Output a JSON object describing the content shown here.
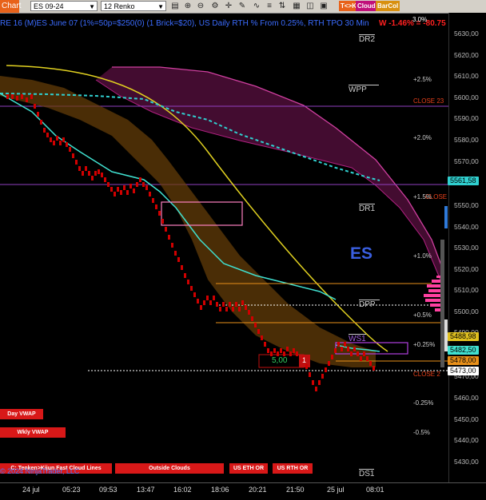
{
  "toolbar": {
    "chart_tab": "Chart",
    "instrument": "ES 09-24",
    "bar_type": "12 Renko",
    "btn_tok": "T<>K",
    "btn_cloud": "Cloud",
    "btn_barcol": "BarCol"
  },
  "header": {
    "title": "RE 16 (M)ES June 07 (1%=50p=$250(0) (1 Brick=$20), US Daily RTH % From 0.25%, RTH TPO 30 Min",
    "performance": "W -1.46% = -80.75",
    "top_pct": "3.0%"
  },
  "price_axis": [
    "5630,00",
    "5620,00",
    "5610,00",
    "5600,00",
    "5590,00",
    "5580,00",
    "5570,00",
    "5550,00",
    "5540,00",
    "5530,00",
    "5520,00",
    "5510,00",
    "5500,00",
    "5490,00",
    "5470,00",
    "5460,00",
    "5450,00",
    "5440,00",
    "5430,00"
  ],
  "price_tags": {
    "tag1": "5561,58",
    "tag2": "5488,98",
    "tag3": "5482,50",
    "tag4": "5478,00",
    "tag5": "5473,00"
  },
  "levels": {
    "dr2": "DR2",
    "wpp": "WPP",
    "dr1": "DR1",
    "dpp": "DPP",
    "ws1": "WS1",
    "ds1": "DS1",
    "close1": "CLOSE 23",
    "close2": "CLOSE 19",
    "close3": "CLOSE 2",
    "es_label": "ES"
  },
  "pct_labels": {
    "p25": "+2.5%",
    "p20": "+2.0%",
    "p15": "+1.5%",
    "p10": "+1.0%",
    "p05": "+0.5%",
    "p025": "+0.25%",
    "m025": "-0.25%",
    "m05": "-0.5%"
  },
  "box_labels": {
    "range_value": "5,00",
    "marker": "1"
  },
  "buttons": {
    "day_vwap": "Day VWAP",
    "wkly_vwap": "Wkly VWAP",
    "tenken": "C: Tenken>Kijun Fast Cloud Lines",
    "outside": "Outside Clouds",
    "eth": "US ETH OR",
    "rth": "US RTH OR"
  },
  "footer": {
    "copyright": "© 2024 NinjaTrader, LLC"
  },
  "time_axis": [
    "24 jul",
    "05:23",
    "09:53",
    "13:47",
    "16:02",
    "18:06",
    "20:21",
    "21:50",
    "25 jul",
    "08:01"
  ],
  "colors": {
    "bull": "#d00000",
    "ema_fast": "#40e0d0",
    "ema_slow": "#30d0d0",
    "cloud_orange": "#7a4a10",
    "cloud_magenta": "#5a1040",
    "curve": "#e0d020",
    "accent": "#e8621a"
  }
}
